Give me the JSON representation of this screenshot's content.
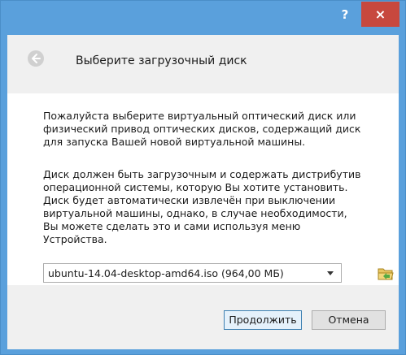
{
  "window": {
    "help_label": "?",
    "close_label": "×"
  },
  "header": {
    "title": "Выберите загрузочный диск"
  },
  "content": {
    "paragraph1_lines": [
      "Пожалуйста выберите виртуальный оптический диск или",
      "физический привод оптических дисков, содержащий диск",
      "для запуска Вашей новой виртуальной машины."
    ],
    "paragraph2_lines": [
      "Диск должен быть загрузочным и содержать дистрибутив",
      "операционной системы, которую Вы хотите установить.",
      "Диск будет автоматически извлечён при выключении",
      "виртуальной машины, однако, в случае необходимости,",
      "Вы можете сделать это и сами используя меню",
      "Устройства."
    ]
  },
  "disk_select": {
    "selected": "ubuntu-14.04-desktop-amd64.iso (964,00 МБ)"
  },
  "buttons": {
    "continue_label": "Продолжить",
    "cancel_label": "Отмена"
  },
  "colors": {
    "titlebar": "#5aa0dc",
    "close_button": "#c7483e",
    "panel_gray": "#f0f0f0"
  },
  "icons": [
    "back-arrow-icon",
    "folder-icon",
    "chevron-down-icon",
    "close-icon",
    "help-icon"
  ]
}
